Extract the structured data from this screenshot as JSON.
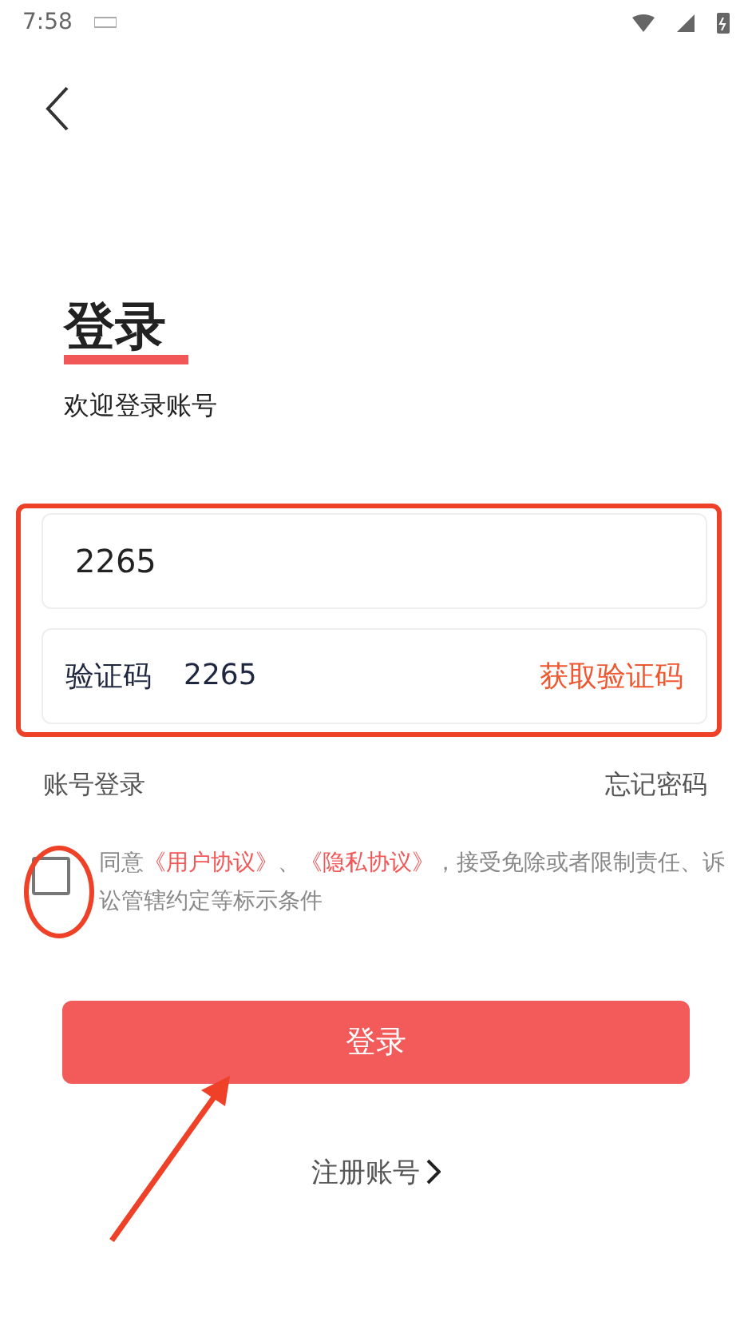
{
  "status_bar": {
    "time": "7:58"
  },
  "title": "登录",
  "subtitle": "欢迎登录账号",
  "phone_field": {
    "value": "2265"
  },
  "code_field": {
    "label": "验证码",
    "value": "2265",
    "action": "获取验证码"
  },
  "links": {
    "left": "账号登录",
    "right": "忘记密码"
  },
  "agreement": {
    "checked": false,
    "segments": [
      {
        "text": "同意",
        "link": false
      },
      {
        "text": "《用户协议》",
        "link": true
      },
      {
        "text": "、",
        "link": false
      },
      {
        "text": "《隐私协议》",
        "link": true
      },
      {
        "text": "，接受免除或者限制责任、诉讼管辖约定等标示条件",
        "link": false
      }
    ]
  },
  "login_button": "登录",
  "register_link": "注册账号"
}
